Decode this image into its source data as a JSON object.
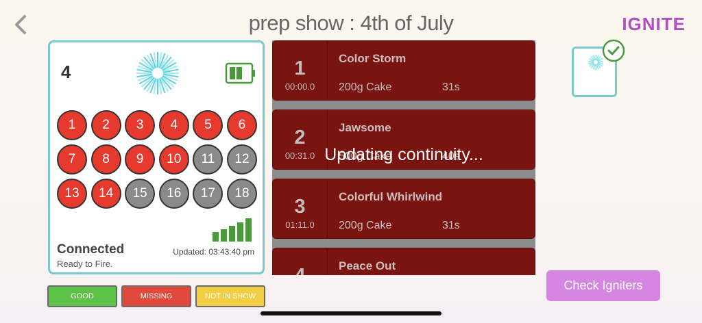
{
  "header": {
    "title": "prep show :  4th of July",
    "brand": "IGNITE",
    "back_icon": "chevron-left-icon"
  },
  "module": {
    "number": "4",
    "status_title": "Connected",
    "status_sub": "Ready to Fire.",
    "updated": "Updated: 03:43:40 pm",
    "battery_level": 0.67,
    "signal_bars": 5,
    "cues": [
      {
        "label": "1",
        "state": "red"
      },
      {
        "label": "2",
        "state": "red"
      },
      {
        "label": "3",
        "state": "red"
      },
      {
        "label": "4",
        "state": "red"
      },
      {
        "label": "5",
        "state": "red"
      },
      {
        "label": "6",
        "state": "red"
      },
      {
        "label": "7",
        "state": "red"
      },
      {
        "label": "8",
        "state": "red"
      },
      {
        "label": "9",
        "state": "red"
      },
      {
        "label": "10",
        "state": "red"
      },
      {
        "label": "11",
        "state": "gray"
      },
      {
        "label": "12",
        "state": "gray"
      },
      {
        "label": "13",
        "state": "red"
      },
      {
        "label": "14",
        "state": "red"
      },
      {
        "label": "15",
        "state": "gray"
      },
      {
        "label": "16",
        "state": "gray"
      },
      {
        "label": "17",
        "state": "gray"
      },
      {
        "label": "18",
        "state": "gray"
      }
    ]
  },
  "show_cues": [
    {
      "num": "1",
      "time": "00:00.0",
      "name": "Color Storm",
      "desc": "200g Cake",
      "dur": "31s"
    },
    {
      "num": "2",
      "time": "00:31.0",
      "name": "Jawsome",
      "desc": "500g Cake",
      "dur": "40s"
    },
    {
      "num": "3",
      "time": "01:11.0",
      "name": "Colorful Whirlwind",
      "desc": "200g Cake",
      "dur": "31s"
    },
    {
      "num": "4",
      "time": "",
      "name": "Peace Out",
      "desc": "",
      "dur": ""
    }
  ],
  "overlay": "Updating continuity...",
  "legend": {
    "good": "GOOD",
    "missing": "MISSING",
    "not_in_show": "NOT IN SHOW"
  },
  "check_button": "Check Igniters",
  "colors": {
    "accent": "#79c9cf",
    "brand": "#b24fc7",
    "cue_red": "#e63a2e",
    "cue_gray": "#8a8a8a",
    "row_bg": "#7a1410",
    "button": "#d486e2"
  }
}
